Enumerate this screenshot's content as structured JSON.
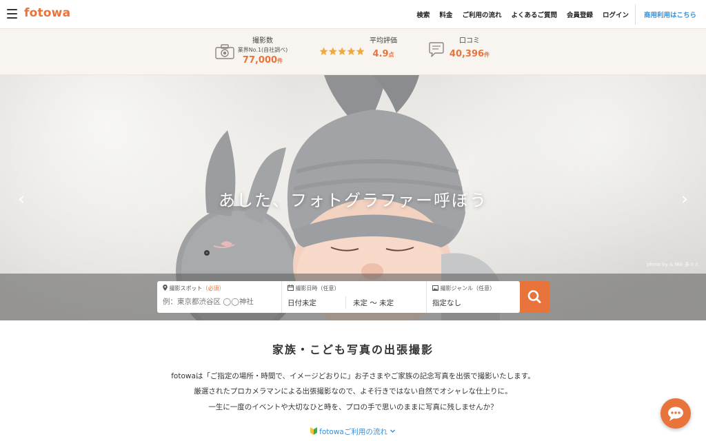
{
  "header": {
    "logo": "fotowa",
    "nav": [
      "検索",
      "料金",
      "ご利用の流れ",
      "よくあるご質問",
      "会員登録",
      "ログイン"
    ],
    "biz_link": "商用利用はこちら"
  },
  "stats": {
    "shots": {
      "label": "撮影数",
      "sub": "業界No.1(自社調べ)",
      "value": "77,000",
      "unit": "件"
    },
    "rating": {
      "label": "平均評価",
      "value": "4.9",
      "unit": "点",
      "stars": 5
    },
    "reviews": {
      "label": "口コミ",
      "value": "40,396",
      "unit": "件"
    }
  },
  "hero": {
    "title": "あした、フォトグラファー呼ぼう",
    "credit": "photo by & Mik 多々ミ",
    "prev_icon": "chevron-left-icon",
    "next_icon": "chevron-right-icon"
  },
  "search": {
    "spot_label": "撮影スポット",
    "spot_required": "（必須）",
    "spot_placeholder": "例：東京都渋谷区 ◯◯神社",
    "date_label": "撮影日時（任意）",
    "date_value": "日付未定",
    "time_value": "未定 ～ 未定",
    "genre_label": "撮影ジャンル（任意）",
    "genre_value": "指定なし"
  },
  "intro": {
    "title": "家族・こども写真の出張撮影",
    "lines": [
      "fotowaは「ご指定の場所・時間で、イメージどおりに」お子さまやご家族の記念写真を出張で撮影いたします。",
      "厳選されたプロカメラマンによる出張撮影なので、よそ行きではない自然でオシャレな仕上りに。",
      "一生に一度のイベントや大切なひと時を、プロの手で思いのままに写真に残しませんか？"
    ],
    "flow_link": "fotowaご利用の流れ"
  },
  "colors": {
    "accent": "#e8743b",
    "link": "#3a8fd6",
    "star": "#f2a93b"
  }
}
